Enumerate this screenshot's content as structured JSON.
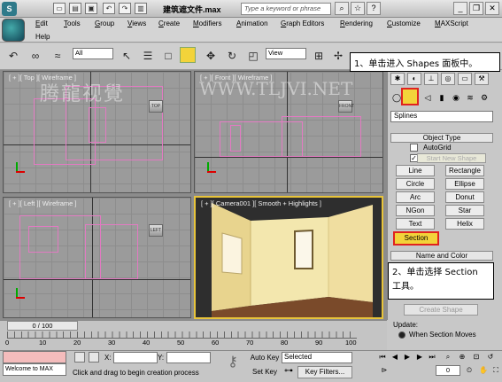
{
  "window": {
    "title": "建筑遮文件.max",
    "search_placeholder": "Type a keyword or phrase"
  },
  "menu": [
    "Edit",
    "Tools",
    "Group",
    "Views",
    "Create",
    "Modifiers",
    "Animation",
    "Graph Editors",
    "Rendering",
    "Customize",
    "MAXScript",
    "Help"
  ],
  "toolbar": {
    "filter_value": "All",
    "refcoord_value": "View"
  },
  "callouts": {
    "step1": "1、单击进入 Shapes 面板中。",
    "step2_line1": "2、单击选择 Section",
    "step2_line2": "工具。"
  },
  "viewports": {
    "top": "[ + ][ Top ][ Wireframe ]",
    "front": "[ + ][ Front ][ Wireframe ]",
    "left": "[ + ][ Left ][ Wireframe ]",
    "camera": "[ + ][ Camera001 ][ Smooth + Highlights ]",
    "top_cube": "TOP",
    "front_cube": "FRONT",
    "left_cube": "LEFT"
  },
  "watermark": {
    "left": "腾龍视覺",
    "right": "WWW.TLJVI.NET"
  },
  "command_panel": {
    "category": "Splines",
    "object_type_title": "Object Type",
    "autogrid_label": "AutoGrid",
    "start_new_shape": "Start New Shape",
    "buttons": [
      "Line",
      "Rectangle",
      "Circle",
      "Ellipse",
      "Arc",
      "Donut",
      "NGon",
      "Star",
      "Text",
      "Helix"
    ],
    "section_button": "Section",
    "name_color_title": "Name and Color",
    "create_shape": "Create Shape",
    "update_label": "Update:",
    "update_option": "When Section Moves"
  },
  "timeline": {
    "frame_slider": "0 / 100",
    "ticks": [
      "0",
      "10",
      "20",
      "30",
      "40",
      "50",
      "60",
      "70",
      "80",
      "90",
      "100"
    ]
  },
  "status": {
    "welcome": "Welcome to MAX",
    "prompt": "Click and drag to begin creation process",
    "x_label": "X:",
    "y_label": "Y:",
    "autokey": "Auto Key",
    "setkey": "Set Key",
    "selected_value": "Selected",
    "key_filters": "Key Filters...",
    "frame_value": "0"
  }
}
